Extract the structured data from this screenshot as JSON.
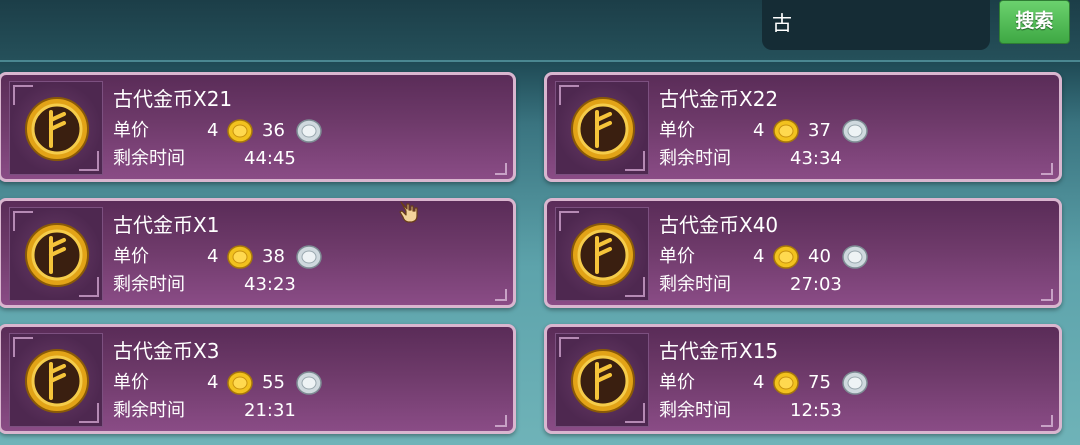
{
  "search": {
    "query": "古",
    "button_label": "搜索"
  },
  "labels": {
    "price": "单价",
    "time_left": "剩余时间"
  },
  "icons": {
    "item": "ancient-gold-coin-icon",
    "gold": "gold-coin-icon",
    "silver": "silver-coin-icon",
    "cursor": "hand-cursor-icon"
  },
  "colors": {
    "card": "#6e3a6a",
    "card_border": "#d9b6cf",
    "search_button": "#4fbb55"
  },
  "listings": [
    {
      "name": "古代金币X21",
      "gold": "4",
      "silver": "36",
      "time": "44:45"
    },
    {
      "name": "古代金币X22",
      "gold": "4",
      "silver": "37",
      "time": "43:34"
    },
    {
      "name": "古代金币X1",
      "gold": "4",
      "silver": "38",
      "time": "43:23"
    },
    {
      "name": "古代金币X40",
      "gold": "4",
      "silver": "40",
      "time": "27:03"
    },
    {
      "name": "古代金币X3",
      "gold": "4",
      "silver": "55",
      "time": "21:31"
    },
    {
      "name": "古代金币X15",
      "gold": "4",
      "silver": "75",
      "time": "12:53"
    }
  ]
}
